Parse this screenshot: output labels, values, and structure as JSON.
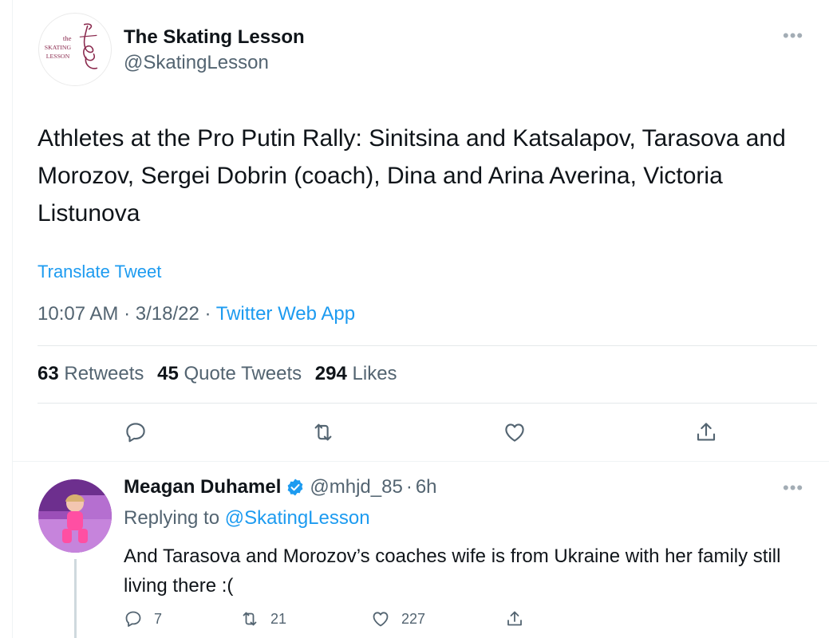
{
  "main_tweet": {
    "author": {
      "name": "The Skating Lesson",
      "handle": "@SkatingLesson",
      "avatar_logo_lines": [
        "the",
        "SKATING",
        "LESSON"
      ]
    },
    "more_icon": "more-horizontal-icon",
    "text": "Athletes at the Pro Putin Rally: Sinitsina and Katsalapov, Tarasova and Morozov, Sergei Dobrin (coach), Dina and Arina Averina, Victoria Listunova",
    "translate_label": "Translate Tweet",
    "time": "10:07 AM",
    "date": "3/18/22",
    "separator": "·",
    "source": "Twitter Web App",
    "stats": {
      "retweets_count": "63",
      "retweets_label": "Retweets",
      "quotes_count": "45",
      "quotes_label": "Quote Tweets",
      "likes_count": "294",
      "likes_label": "Likes"
    },
    "actions": [
      "reply-icon",
      "retweet-icon",
      "like-icon",
      "share-icon"
    ]
  },
  "reply": {
    "author": {
      "name": "Meagan Duhamel",
      "verified": true,
      "handle": "@mhjd_85",
      "separator": "·",
      "time": "6h"
    },
    "replying_prefix": "Replying to",
    "replying_to": "@SkatingLesson",
    "text": "And Tarasova and Morozov’s coaches wife is from Ukraine with her family still living there :(",
    "counts": {
      "replies": "7",
      "retweets": "21",
      "likes": "227"
    }
  },
  "colors": {
    "text": "#0f1419",
    "secondary": "#536471",
    "link": "#1d9bf0",
    "logo_accent": "#8a2a4e"
  }
}
